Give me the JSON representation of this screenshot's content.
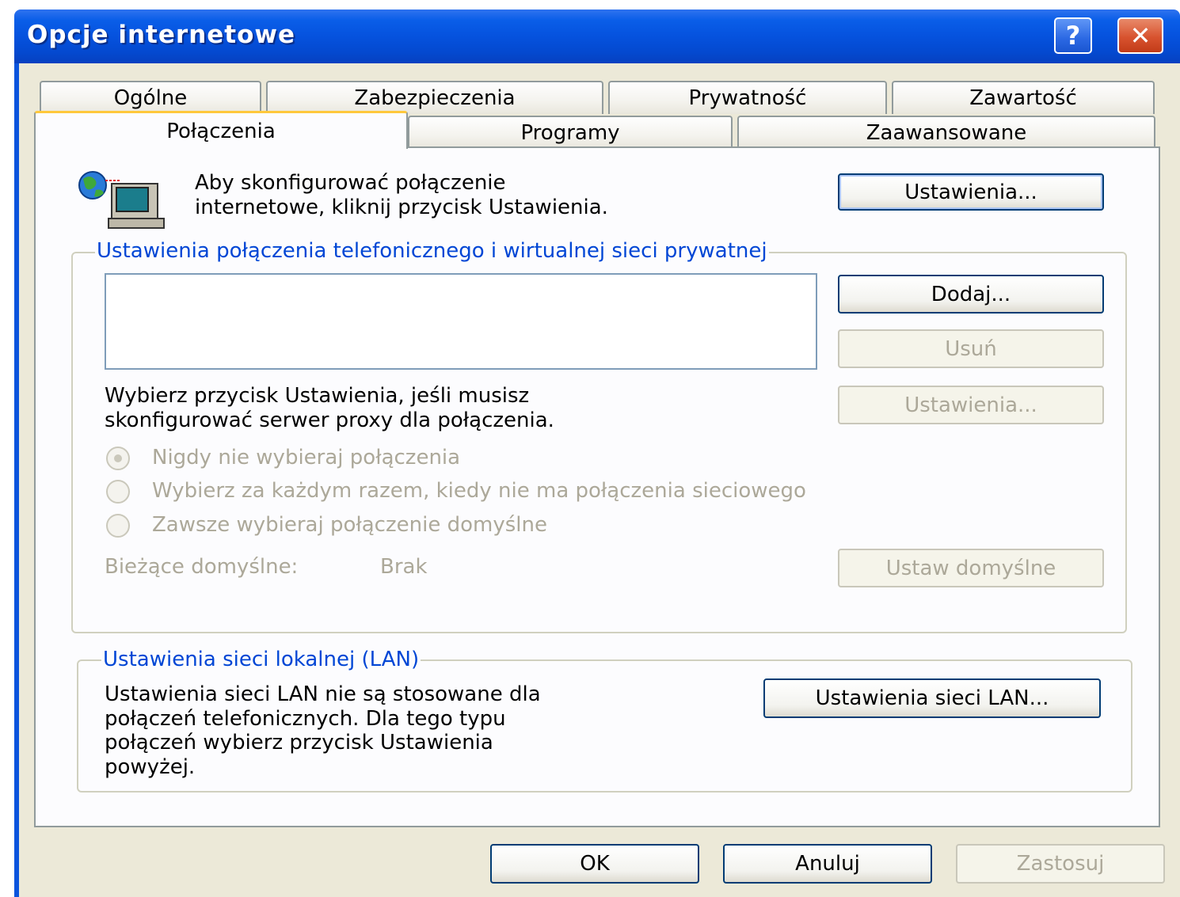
{
  "window": {
    "title": "Opcje internetowe",
    "help_symbol": "?",
    "close_symbol": "✕"
  },
  "tabs": {
    "row1": [
      "Ogólne",
      "Zabezpieczenia",
      "Prywatność",
      "Zawartość"
    ],
    "row2": [
      "Połączenia",
      "Programy",
      "Zaawansowane"
    ],
    "active": "Połączenia"
  },
  "setup": {
    "line1": "Aby skonfigurować połączenie",
    "line2": "internetowe, kliknij przycisk Ustawienia.",
    "button": "Ustawienia..."
  },
  "dialup": {
    "legend": "Ustawienia połączenia telefonicznego i wirtualnej sieci prywatnej",
    "add_button": "Dodaj...",
    "remove_button": "Usuń",
    "settings_button": "Ustawienia...",
    "proxy_line1": "Wybierz przycisk Ustawienia, jeśli musisz",
    "proxy_line2": "skonfigurować serwer proxy dla połączenia.",
    "radio_never": "Nigdy nie wybieraj połączenia",
    "radio_whenever": "Wybierz za każdym razem, kiedy nie ma połączenia sieciowego",
    "radio_always": "Zawsze wybieraj połączenie domyślne",
    "current_default_label": "Bieżące domyślne:",
    "current_default_value": "Brak",
    "set_default_button": "Ustaw domyślne"
  },
  "lan": {
    "legend": "Ustawienia sieci lokalnej (LAN)",
    "line1": "Ustawienia sieci LAN nie są stosowane dla",
    "line2": "połączeń telefonicznych. Dla tego typu",
    "line3": "połączeń wybierz przycisk Ustawienia",
    "line4": "powyżej.",
    "button": "Ustawienia sieci LAN..."
  },
  "footer": {
    "ok": "OK",
    "cancel": "Anuluj",
    "apply": "Zastosuj"
  },
  "colors": {
    "titlebar": "#0552de",
    "legend_text": "#0046d5",
    "disabled_text": "#aca899",
    "dialog_bg": "#ece9d8"
  }
}
